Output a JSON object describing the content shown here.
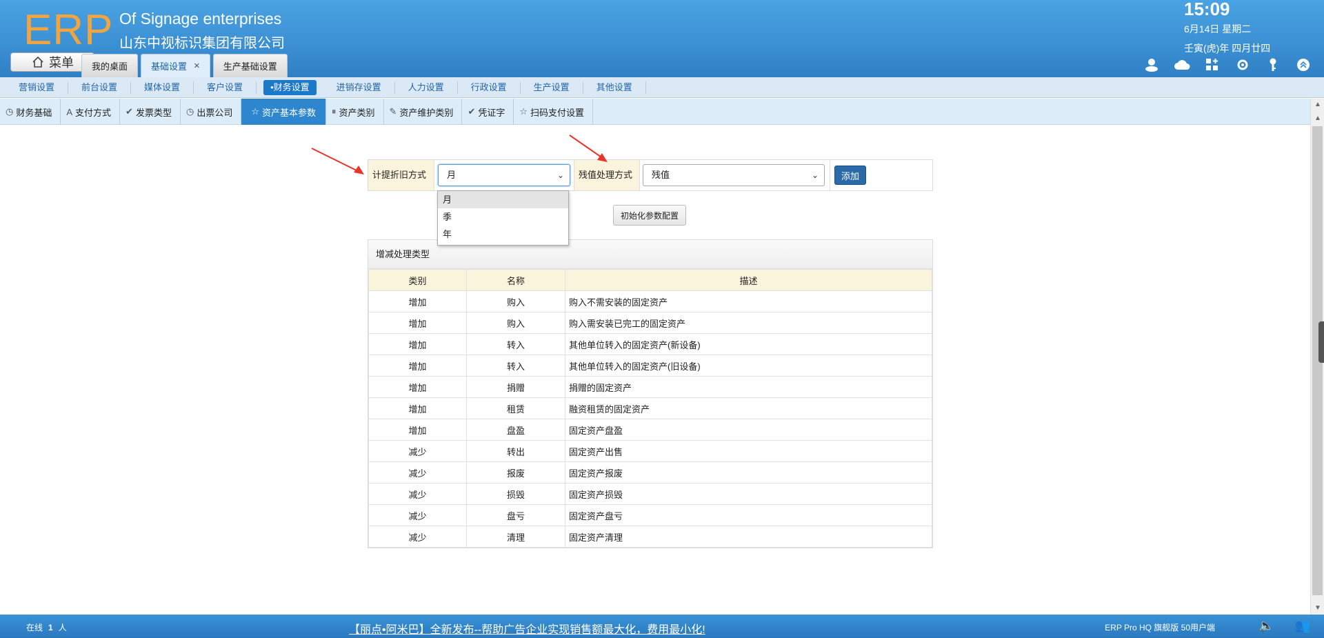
{
  "header": {
    "logo": "ERP",
    "company_en": "Of Signage enterprises",
    "company_cn": "山东中视标识集团有限公司",
    "time": "15:09",
    "date": "6月14日 星期二",
    "lunar": "壬寅(虎)年 四月廿四",
    "menu_label": "菜单",
    "tabs": [
      {
        "label": "我的桌面"
      },
      {
        "label": "基础设置",
        "close": "×"
      },
      {
        "label": "生产基础设置"
      }
    ],
    "icons": [
      "user-icon",
      "cloud-icon",
      "apps-icon",
      "gear-icon",
      "key-icon",
      "collapse-icon"
    ]
  },
  "nav1": {
    "items": [
      "营销设置",
      "前台设置",
      "媒体设置",
      "客户设置",
      "•财务设置",
      "进销存设置",
      "人力设置",
      "行政设置",
      "生产设置",
      "其他设置"
    ],
    "active": "•财务设置"
  },
  "nav2": {
    "items": [
      {
        "label": "财务基础",
        "icon": "clock-icon",
        "glyph": "◷"
      },
      {
        "label": "支付方式",
        "icon": "font-icon",
        "glyph": "A"
      },
      {
        "label": "发票类型",
        "icon": "check-icon",
        "glyph": "✔"
      },
      {
        "label": "出票公司",
        "icon": "clock-icon",
        "glyph": "◷"
      },
      {
        "label": "资产基本参数",
        "icon": "star-icon",
        "glyph": "☆"
      },
      {
        "label": "资产类别",
        "icon": "pause-icon",
        "glyph": "⏸"
      },
      {
        "label": "资产维护类别",
        "icon": "pencil-icon",
        "glyph": "✎"
      },
      {
        "label": "凭证字",
        "icon": "check-icon",
        "glyph": "✔"
      },
      {
        "label": "扫码支付设置",
        "icon": "star-icon",
        "glyph": "☆"
      }
    ],
    "active": "资产基本参数"
  },
  "form": {
    "depreciation_label": "计提折旧方式",
    "depreciation_value": "月",
    "depreciation_options": [
      "月",
      "季",
      "年"
    ],
    "residual_label": "残值处理方式",
    "residual_value": "残值",
    "add_label": "添加",
    "init_label": "初始化参数配置"
  },
  "panel": {
    "title": "增减处理类型",
    "columns": [
      "类别",
      "名称",
      "描述"
    ],
    "rows": [
      [
        "增加",
        "购入",
        "购入不需安装的固定资产"
      ],
      [
        "增加",
        "购入",
        "购入需安装已完工的固定资产"
      ],
      [
        "增加",
        "转入",
        "其他单位转入的固定资产(新设备)"
      ],
      [
        "增加",
        "转入",
        "其他单位转入的固定资产(旧设备)"
      ],
      [
        "增加",
        "捐赠",
        "捐赠的固定资产"
      ],
      [
        "增加",
        "租赁",
        "融资租赁的固定资产"
      ],
      [
        "增加",
        "盘盈",
        "固定资产盘盈"
      ],
      [
        "减少",
        "转出",
        "固定资产出售"
      ],
      [
        "减少",
        "报废",
        "固定资产报废"
      ],
      [
        "减少",
        "损毁",
        "固定资产损毁"
      ],
      [
        "减少",
        "盘亏",
        "固定资产盘亏"
      ],
      [
        "减少",
        "清理",
        "固定资产清理"
      ]
    ]
  },
  "status": {
    "online_label": "在线",
    "online_count": "1",
    "online_unit": "人",
    "marquee": "【丽点•阿米巴】全新发布--帮助广告企业实现销售额最大化，费用最小化!",
    "version": "ERP Pro HQ 旗舰版 50用户端"
  }
}
